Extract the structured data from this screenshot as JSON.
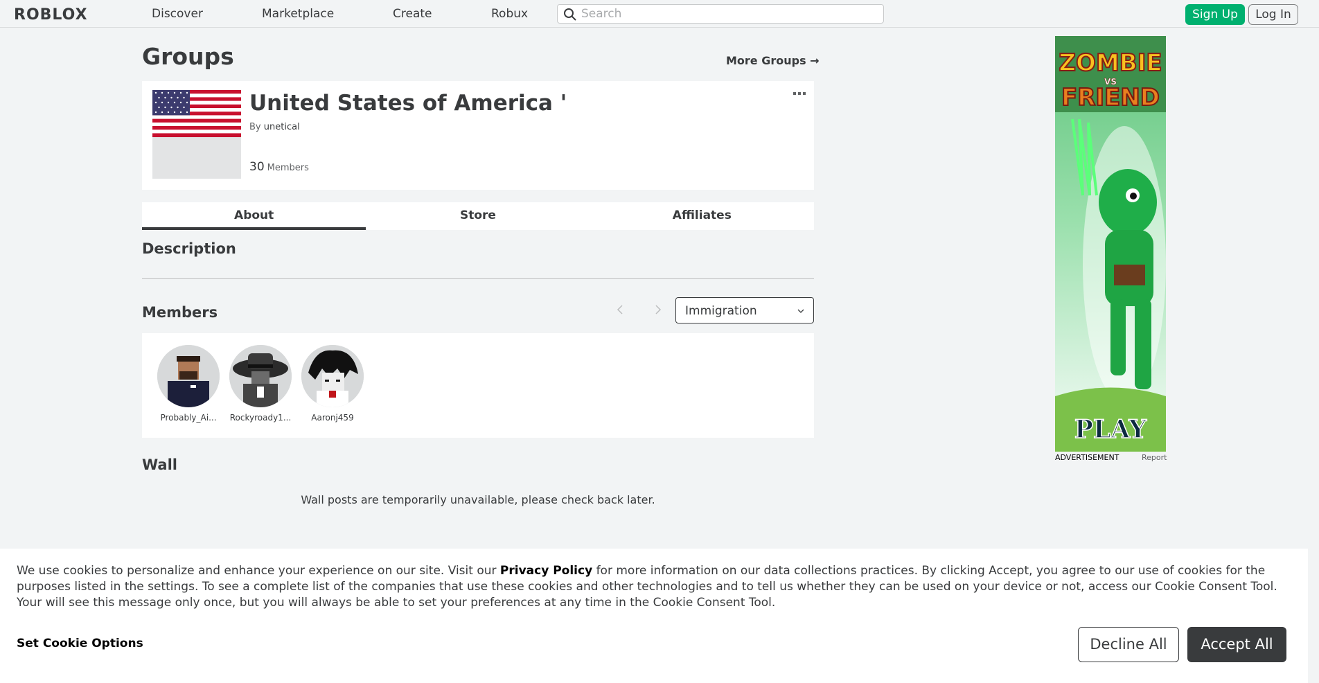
{
  "nav": {
    "logo": "ROBLOX",
    "links": [
      "Discover",
      "Marketplace",
      "Create",
      "Robux"
    ],
    "search_placeholder": "Search",
    "signup": "Sign Up",
    "login": "Log In"
  },
  "page": {
    "title": "Groups",
    "more_groups": "More Groups →"
  },
  "group": {
    "name": "United States of America '",
    "owner_prefix": "By",
    "owner": "unetical",
    "member_count": "30",
    "member_label": "Members"
  },
  "tabs": [
    "About",
    "Store",
    "Affiliates"
  ],
  "sections": {
    "description": "Description",
    "members": "Members",
    "wall": "Wall"
  },
  "role_filter": {
    "selected": "Immigration"
  },
  "members": [
    {
      "name": "Probably_Ai..."
    },
    {
      "name": "Rockyroady1..."
    },
    {
      "name": "Aaronj459"
    }
  ],
  "wall_message": "Wall posts are temporarily unavailable, please check back later.",
  "ad": {
    "label": "ADVERTISEMENT",
    "report": "Report",
    "title_top": "ZOMBIE",
    "title_vs": "VS",
    "title_bottom": "FRIEND",
    "cta": "PLAY"
  },
  "cookie": {
    "text_before": "We use cookies to personalize and enhance your experience on our site. Visit our ",
    "link": "Privacy Policy",
    "text_after": " for more information on our data collections practices. By clicking Accept, you agree to our use of cookies for the purposes listed in the settings. To see a complete list of the companies that use these cookies and other technologies and to tell us whether they can be used on your device or not, access our Cookie Consent Tool. Your will see this message only once, but you will always be able to set your preferences at any time in the Cookie Consent Tool.",
    "options": "Set Cookie Options",
    "decline": "Decline All",
    "accept": "Accept All"
  },
  "colors": {
    "accent_green": "#00b06f",
    "text_dark": "#393b3d",
    "page_bg": "#f2f4f5"
  }
}
